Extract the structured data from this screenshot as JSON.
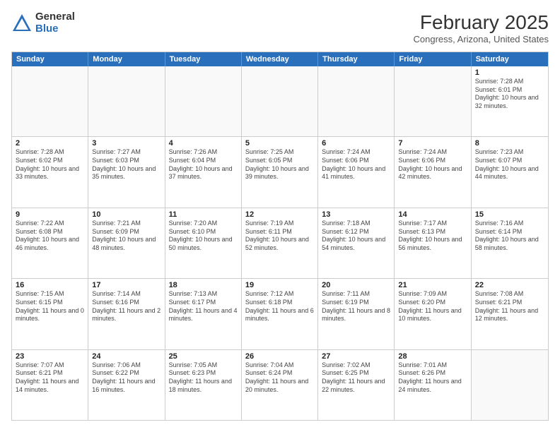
{
  "logo": {
    "general": "General",
    "blue": "Blue"
  },
  "title": "February 2025",
  "subtitle": "Congress, Arizona, United States",
  "days": [
    "Sunday",
    "Monday",
    "Tuesday",
    "Wednesday",
    "Thursday",
    "Friday",
    "Saturday"
  ],
  "weeks": [
    [
      {
        "num": "",
        "text": ""
      },
      {
        "num": "",
        "text": ""
      },
      {
        "num": "",
        "text": ""
      },
      {
        "num": "",
        "text": ""
      },
      {
        "num": "",
        "text": ""
      },
      {
        "num": "",
        "text": ""
      },
      {
        "num": "1",
        "text": "Sunrise: 7:28 AM\nSunset: 6:01 PM\nDaylight: 10 hours and 32 minutes."
      }
    ],
    [
      {
        "num": "2",
        "text": "Sunrise: 7:28 AM\nSunset: 6:02 PM\nDaylight: 10 hours and 33 minutes."
      },
      {
        "num": "3",
        "text": "Sunrise: 7:27 AM\nSunset: 6:03 PM\nDaylight: 10 hours and 35 minutes."
      },
      {
        "num": "4",
        "text": "Sunrise: 7:26 AM\nSunset: 6:04 PM\nDaylight: 10 hours and 37 minutes."
      },
      {
        "num": "5",
        "text": "Sunrise: 7:25 AM\nSunset: 6:05 PM\nDaylight: 10 hours and 39 minutes."
      },
      {
        "num": "6",
        "text": "Sunrise: 7:24 AM\nSunset: 6:06 PM\nDaylight: 10 hours and 41 minutes."
      },
      {
        "num": "7",
        "text": "Sunrise: 7:24 AM\nSunset: 6:06 PM\nDaylight: 10 hours and 42 minutes."
      },
      {
        "num": "8",
        "text": "Sunrise: 7:23 AM\nSunset: 6:07 PM\nDaylight: 10 hours and 44 minutes."
      }
    ],
    [
      {
        "num": "9",
        "text": "Sunrise: 7:22 AM\nSunset: 6:08 PM\nDaylight: 10 hours and 46 minutes."
      },
      {
        "num": "10",
        "text": "Sunrise: 7:21 AM\nSunset: 6:09 PM\nDaylight: 10 hours and 48 minutes."
      },
      {
        "num": "11",
        "text": "Sunrise: 7:20 AM\nSunset: 6:10 PM\nDaylight: 10 hours and 50 minutes."
      },
      {
        "num": "12",
        "text": "Sunrise: 7:19 AM\nSunset: 6:11 PM\nDaylight: 10 hours and 52 minutes."
      },
      {
        "num": "13",
        "text": "Sunrise: 7:18 AM\nSunset: 6:12 PM\nDaylight: 10 hours and 54 minutes."
      },
      {
        "num": "14",
        "text": "Sunrise: 7:17 AM\nSunset: 6:13 PM\nDaylight: 10 hours and 56 minutes."
      },
      {
        "num": "15",
        "text": "Sunrise: 7:16 AM\nSunset: 6:14 PM\nDaylight: 10 hours and 58 minutes."
      }
    ],
    [
      {
        "num": "16",
        "text": "Sunrise: 7:15 AM\nSunset: 6:15 PM\nDaylight: 11 hours and 0 minutes."
      },
      {
        "num": "17",
        "text": "Sunrise: 7:14 AM\nSunset: 6:16 PM\nDaylight: 11 hours and 2 minutes."
      },
      {
        "num": "18",
        "text": "Sunrise: 7:13 AM\nSunset: 6:17 PM\nDaylight: 11 hours and 4 minutes."
      },
      {
        "num": "19",
        "text": "Sunrise: 7:12 AM\nSunset: 6:18 PM\nDaylight: 11 hours and 6 minutes."
      },
      {
        "num": "20",
        "text": "Sunrise: 7:11 AM\nSunset: 6:19 PM\nDaylight: 11 hours and 8 minutes."
      },
      {
        "num": "21",
        "text": "Sunrise: 7:09 AM\nSunset: 6:20 PM\nDaylight: 11 hours and 10 minutes."
      },
      {
        "num": "22",
        "text": "Sunrise: 7:08 AM\nSunset: 6:21 PM\nDaylight: 11 hours and 12 minutes."
      }
    ],
    [
      {
        "num": "23",
        "text": "Sunrise: 7:07 AM\nSunset: 6:21 PM\nDaylight: 11 hours and 14 minutes."
      },
      {
        "num": "24",
        "text": "Sunrise: 7:06 AM\nSunset: 6:22 PM\nDaylight: 11 hours and 16 minutes."
      },
      {
        "num": "25",
        "text": "Sunrise: 7:05 AM\nSunset: 6:23 PM\nDaylight: 11 hours and 18 minutes."
      },
      {
        "num": "26",
        "text": "Sunrise: 7:04 AM\nSunset: 6:24 PM\nDaylight: 11 hours and 20 minutes."
      },
      {
        "num": "27",
        "text": "Sunrise: 7:02 AM\nSunset: 6:25 PM\nDaylight: 11 hours and 22 minutes."
      },
      {
        "num": "28",
        "text": "Sunrise: 7:01 AM\nSunset: 6:26 PM\nDaylight: 11 hours and 24 minutes."
      },
      {
        "num": "",
        "text": ""
      }
    ]
  ]
}
